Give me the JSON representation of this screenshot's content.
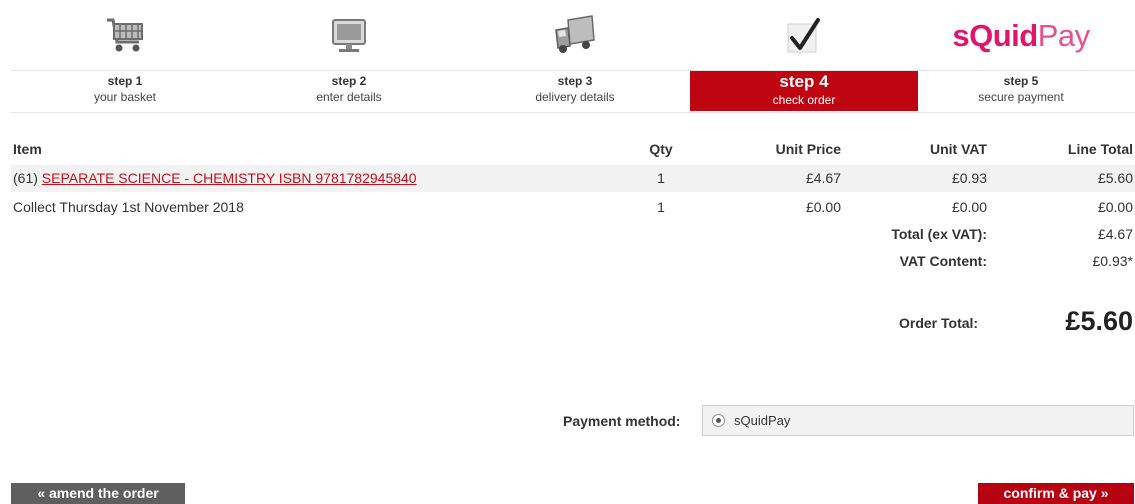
{
  "steps": [
    {
      "num": "step 1",
      "desc": "your basket",
      "icon": "shopping-cart-icon"
    },
    {
      "num": "step 2",
      "desc": "enter details",
      "icon": "computer-monitor-icon"
    },
    {
      "num": "step 3",
      "desc": "delivery details",
      "icon": "delivery-truck-icon"
    },
    {
      "num": "step 4",
      "desc": "check order",
      "icon": "checkmark-icon",
      "active": true
    },
    {
      "num": "step 5",
      "desc": "secure payment",
      "icon": "squidpay-logo"
    }
  ],
  "brand": {
    "part1": "s",
    "part2": "Quid",
    "part3": "Pay"
  },
  "table": {
    "headers": {
      "item": "Item",
      "qty": "Qty",
      "unit_price": "Unit Price",
      "unit_vat": "Unit VAT",
      "line_total": "Line Total"
    },
    "rows": [
      {
        "prefix": "(61) ",
        "item": "SEPARATE SCIENCE - CHEMISTRY ISBN 9781782945840",
        "qty": "1",
        "unit_price": "£4.67",
        "unit_vat": "£0.93",
        "line_total": "£5.60"
      },
      {
        "prefix": "",
        "item": "Collect Thursday 1st November 2018",
        "qty": "1",
        "unit_price": "£0.00",
        "unit_vat": "£0.00",
        "line_total": "£0.00"
      }
    ],
    "summary": [
      {
        "label": "Total (ex VAT):",
        "value": "£4.67"
      },
      {
        "label": "VAT Content:",
        "value": "£0.93*"
      }
    ],
    "order_total_label": "Order Total:",
    "order_total_value": "£5.60"
  },
  "payment": {
    "label": "Payment method:",
    "option": "sQuidPay",
    "selected": true
  },
  "buttons": {
    "amend": "« amend the order",
    "confirm": "confirm & pay »"
  },
  "colors": {
    "accent": "#bf0412",
    "brand": "#e2156b",
    "amend_button": "#5f5f5f",
    "link": "#c4101c"
  }
}
